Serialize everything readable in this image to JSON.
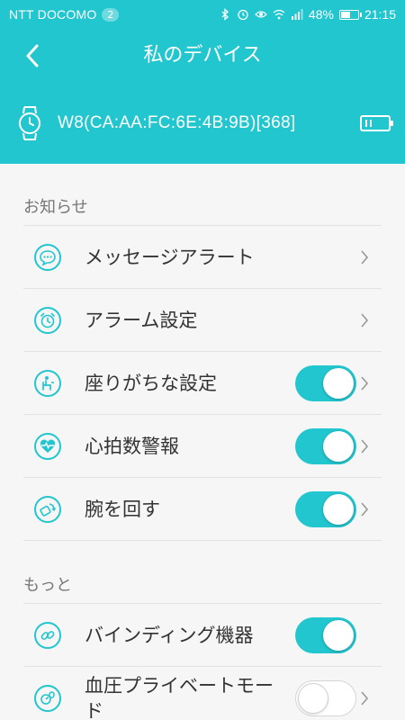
{
  "status_bar": {
    "carrier": "NTT DOCOMO",
    "notification_count": "2",
    "battery_percent": "48%",
    "battery_level": 0.48,
    "time": "21:15",
    "icons": [
      "bluetooth-icon",
      "alarm-icon",
      "eye-icon",
      "wifi-icon",
      "signal-icon",
      "battery-icon"
    ]
  },
  "header": {
    "title": "私のデバイス",
    "back_icon": "chevron-left-icon"
  },
  "device": {
    "name": "W8(CA:AA:FC:6E:4B:9B)[368]",
    "icon": "watch-icon",
    "battery_icon": "battery-icon"
  },
  "sections": [
    {
      "label": "お知らせ",
      "items": [
        {
          "label": "メッセージアラート",
          "icon": "message-icon",
          "toggle": null
        },
        {
          "label": "アラーム設定",
          "icon": "alarm-clock-icon",
          "toggle": null
        },
        {
          "label": "座りがちな設定",
          "icon": "sedentary-icon",
          "toggle": true
        },
        {
          "label": "心拍数警報",
          "icon": "heart-rate-icon",
          "toggle": true
        },
        {
          "label": "腕を回す",
          "icon": "wrist-icon",
          "toggle": true
        }
      ]
    },
    {
      "label": "もっと",
      "items": [
        {
          "label": "バインディング機器",
          "icon": "link-icon",
          "toggle": true
        },
        {
          "label": "血圧プライベートモード",
          "icon": "blood-pressure-icon",
          "toggle": false
        }
      ]
    }
  ],
  "colors": {
    "accent": "#22c6cf",
    "background": "#f6f6f6",
    "divider": "#e2e2e2"
  }
}
